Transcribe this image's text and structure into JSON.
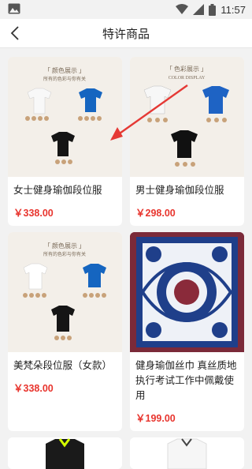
{
  "status": {
    "time": "11:57",
    "icons": [
      "image-icon",
      "wifi-icon",
      "signal-icon",
      "battery-icon"
    ]
  },
  "header": {
    "title": "特许商品",
    "back_icon": "back-chevron-icon"
  },
  "products": [
    {
      "name": "女士健身瑜伽段位服",
      "price": "￥338.00",
      "image": {
        "top_text": "「 颜色展示 」",
        "sub_text": "所有的色彩与你有关"
      }
    },
    {
      "name": "男士健身瑜伽段位服",
      "price": "￥298.00",
      "image": {
        "top_text": "「 色彩展示 」",
        "sub_text": "COLOR DISPLAY"
      }
    },
    {
      "name": "美梵朵段位服（女款）",
      "price": "￥338.00",
      "image": {
        "top_text": "「 颜色展示 」",
        "sub_text": "所有的色彩与你有关"
      }
    },
    {
      "name": "健身瑜伽丝巾 真丝质地执行考试工作中佩戴使用",
      "price": "￥199.00",
      "image": {}
    }
  ],
  "colors": {
    "price": "#e8352e",
    "annotation_arrow": "#e53935",
    "scarf_blue": "#1f3f8a",
    "scarf_red": "#8a2a3a"
  }
}
